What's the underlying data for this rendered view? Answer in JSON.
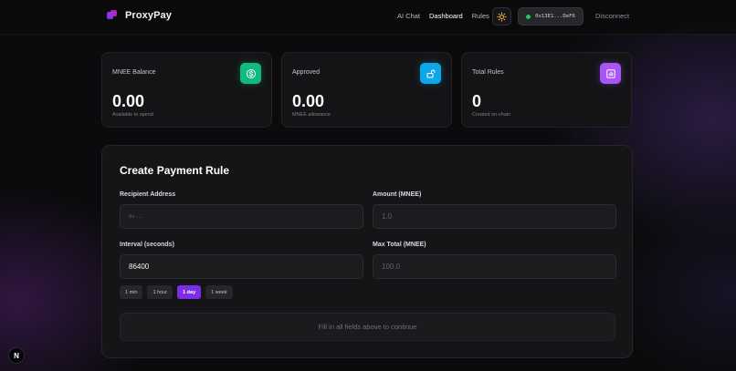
{
  "header": {
    "brand": "ProxyPay",
    "nav": [
      {
        "label": "AI Chat",
        "active": false
      },
      {
        "label": "Dashboard",
        "active": true
      },
      {
        "label": "Rules",
        "active": false
      }
    ],
    "wallet_address": "0x13E1...DeF6",
    "disconnect_label": "Disconnect"
  },
  "stats": [
    {
      "label": "MNEE Balance",
      "value": "0.00",
      "sub": "Available to spend",
      "icon": "dollar-icon",
      "color": "#10b981"
    },
    {
      "label": "Approved",
      "value": "0.00",
      "sub": "MNEE allowance",
      "icon": "unlock-icon",
      "color": "#0ea5e9"
    },
    {
      "label": "Total Rules",
      "value": "0",
      "sub": "Created on-chain",
      "icon": "bar-chart-icon",
      "color": "#a855f7"
    }
  ],
  "form": {
    "title": "Create Payment Rule",
    "recipient_label": "Recipient Address",
    "recipient_placeholder": "0x...",
    "amount_label": "Amount (MNEE)",
    "amount_placeholder": "1.0",
    "interval_label": "Interval (seconds)",
    "interval_value": "86400",
    "max_total_label": "Max Total (MNEE)",
    "max_total_placeholder": "100.0",
    "presets": [
      {
        "label": "1 min",
        "active": false
      },
      {
        "label": "1 hour",
        "active": false
      },
      {
        "label": "1 day",
        "active": true
      },
      {
        "label": "1 week",
        "active": false
      }
    ],
    "submit_label": "Fill in all fields above to continue"
  },
  "badge": "N"
}
